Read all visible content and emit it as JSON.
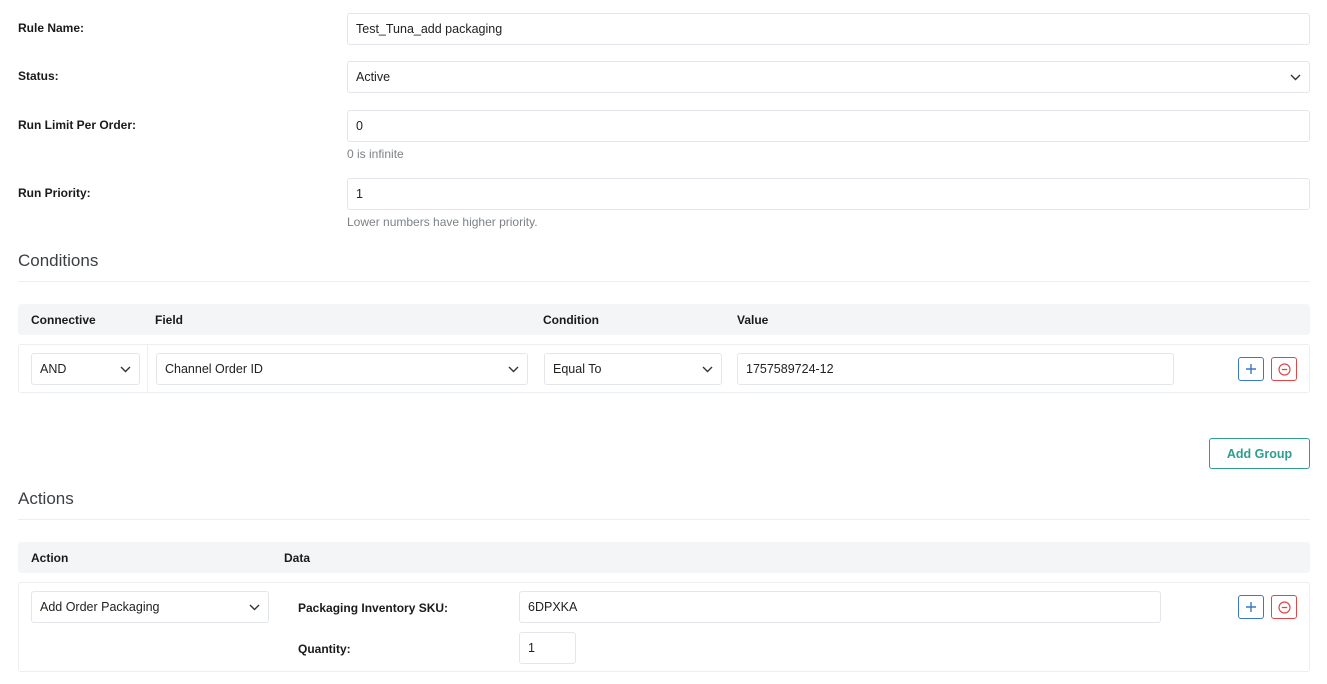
{
  "form": {
    "rule_name": {
      "label": "Rule Name:",
      "value": "Test_Tuna_add packaging"
    },
    "status": {
      "label": "Status:",
      "value": "Active"
    },
    "run_limit": {
      "label": "Run Limit Per Order:",
      "value": "0",
      "help": "0 is infinite"
    },
    "run_priority": {
      "label": "Run Priority:",
      "value": "1",
      "help": "Lower numbers have higher priority."
    }
  },
  "conditions": {
    "title": "Conditions",
    "headers": {
      "connective": "Connective",
      "field": "Field",
      "condition": "Condition",
      "value": "Value"
    },
    "rows": [
      {
        "connective": "AND",
        "field": "Channel Order ID",
        "condition": "Equal To",
        "value": "1757589724-12"
      }
    ],
    "add_group_label": "Add Group"
  },
  "actions": {
    "title": "Actions",
    "headers": {
      "action": "Action",
      "data": "Data"
    },
    "rows": [
      {
        "action": "Add Order Packaging",
        "sku_label": "Packaging Inventory SKU:",
        "sku_value": "6DPXKA",
        "qty_label": "Quantity:",
        "qty_value": "1"
      }
    ]
  },
  "icons": {
    "chevron": "chevron-down-icon",
    "add": "plus-icon",
    "remove": "minus-circle-icon"
  },
  "colors": {
    "add_button": "#3a78c9",
    "remove_button": "#e04848",
    "primary_outline": "#2e9e8e"
  }
}
